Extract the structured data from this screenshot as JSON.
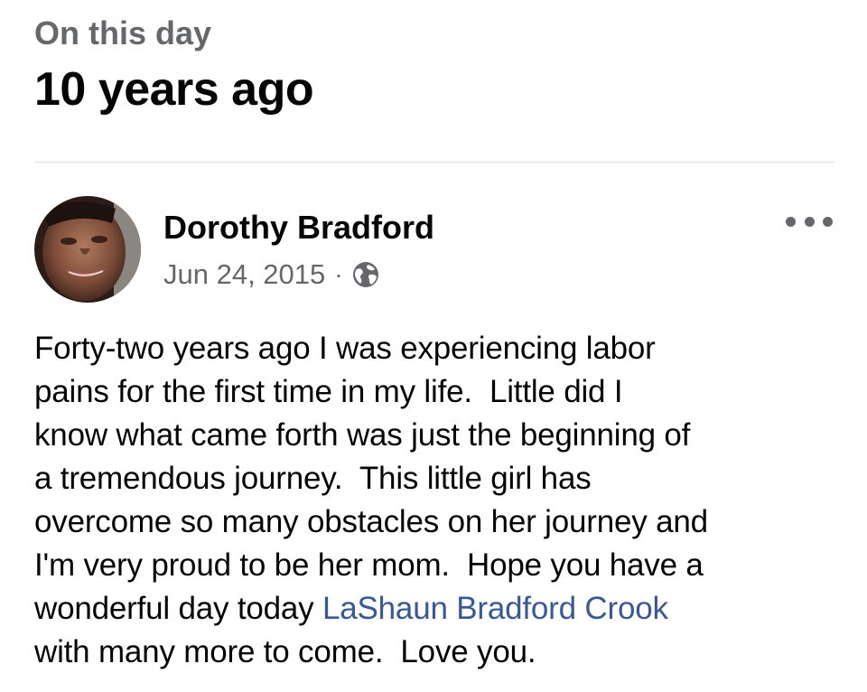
{
  "header": {
    "label": "On this day",
    "title": "10 years ago"
  },
  "post": {
    "author": "Dorothy Bradford",
    "date": "Jun 24, 2015",
    "separator": "·",
    "audience_icon": "globe-icon",
    "more_icon": "more-options-icon",
    "body_lines": [
      "Forty-two years ago I was experiencing labor",
      "pains for the first time in my life.  Little did I",
      "know what came forth was just the beginning of",
      "a tremendous journey.  This little girl has",
      "overcome so many obstacles on her journey and",
      "I'm very proud to be her mom.  Hope you have a"
    ],
    "line7_before_mention": "wonderful day today ",
    "mention": "LaShaun Bradford Crook",
    "last_line": "with many more to come.  Love you."
  },
  "colors": {
    "secondary_text": "#65676b",
    "primary_text": "#050505",
    "mention_link": "#385898",
    "divider": "#dcdde0"
  }
}
